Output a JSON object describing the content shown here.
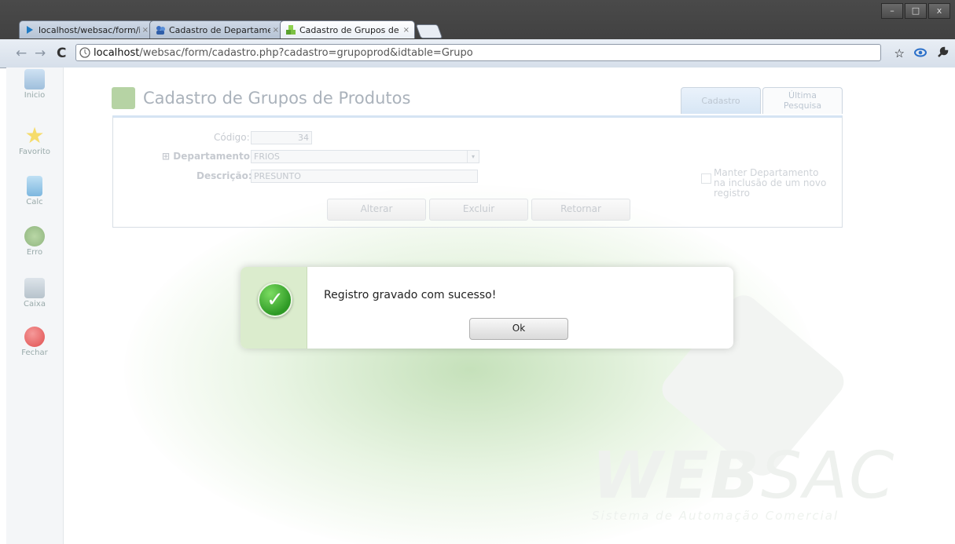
{
  "window": {
    "controls": [
      "–",
      "□",
      "x"
    ]
  },
  "tabs": [
    {
      "label": "localhost/websac/form/ind",
      "close": "×",
      "icon": "arrow-icon",
      "active": false
    },
    {
      "label": "Cadastro de Departamento:",
      "close": "×",
      "icon": "people-icon",
      "active": false
    },
    {
      "label": "Cadastro de Grupos de Proc",
      "close": "×",
      "icon": "cubes-icon",
      "active": true
    }
  ],
  "toolbar": {
    "back": "←",
    "forward": "→",
    "reload": "C",
    "url_host": "localhost",
    "url_path": "/websac/form/cadastro.php?cadastro=grupoprod&idtable=Grupo",
    "star": "☆",
    "wrench": "🔧"
  },
  "sidebar": {
    "items": [
      {
        "label": "Inicio",
        "icon": "home-icon"
      },
      {
        "label": "Favorito",
        "icon": "star-icon"
      },
      {
        "label": "Calc",
        "icon": "calculator-icon"
      },
      {
        "label": "Erro",
        "icon": "bug-icon"
      },
      {
        "label": "Caixa",
        "icon": "cash-register-icon"
      },
      {
        "label": "Fechar",
        "icon": "close-icon"
      }
    ]
  },
  "form": {
    "title": "Cadastro de Grupos de Produtos",
    "tabs": {
      "cadastro": "Cadastro",
      "ultima_1": "Última",
      "ultima_2": "Pesquisa"
    },
    "codigo_label": "Código:",
    "codigo_value": "34",
    "departamento_expand": "⊞",
    "departamento_label": "Departamento:",
    "departamento_value": "FRIOS",
    "descricao_label": "Descrição:",
    "descricao_value": "PRESUNTO",
    "manter_line1": "Manter Departamento",
    "manter_line2": "na inclusão de um novo registro",
    "buttons": {
      "alterar": "Alterar",
      "excluir": "Excluir",
      "retornar": "Retornar"
    }
  },
  "modal": {
    "icon": "check-icon",
    "message": "Registro gravado com sucesso!",
    "ok": "Ok"
  },
  "watermark": {
    "logo_a": "WEB",
    "logo_b": "SAC",
    "tagline": "Sistema de Automação Comercial"
  }
}
